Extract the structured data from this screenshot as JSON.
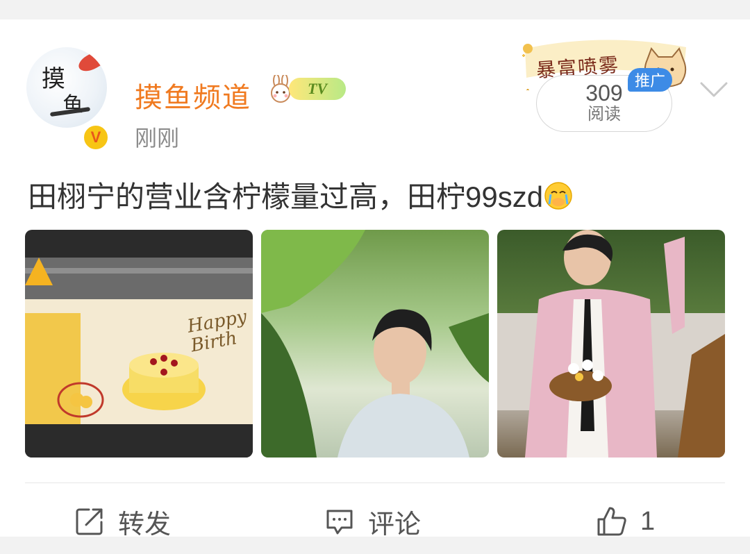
{
  "post": {
    "username": "摸鱼频道",
    "level_badge": "TV",
    "time": "刚刚",
    "text": "田栩宁的营业含柠檬量过高，田柠99szd",
    "avatar_text_top": "摸",
    "avatar_text_bottom": "鱼",
    "verified_mark": "V"
  },
  "ad": {
    "banner_text": "暴富喷雾",
    "promo_label": "推广"
  },
  "reads": {
    "count": "309",
    "label": "阅读"
  },
  "photos": [
    {
      "caption": "Happy Birth"
    },
    {},
    {}
  ],
  "actions": {
    "repost_label": "转发",
    "comment_label": "评论",
    "like_count": "1"
  },
  "colors": {
    "username": "#f07a20",
    "promo": "#3d8be6",
    "verified": "#f7c515"
  },
  "icons": [
    "share-icon",
    "comment-icon",
    "thumbs-up-icon",
    "chevron-down-icon",
    "crying-emoji-icon"
  ]
}
